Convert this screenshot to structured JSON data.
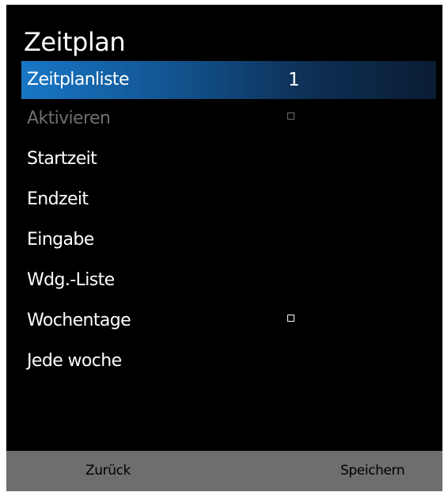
{
  "menu": {
    "title": "Zeitplan",
    "items": [
      {
        "label": "Zeitplanliste",
        "value": "1"
      },
      {
        "label": "Aktivieren"
      },
      {
        "label": "Startzeit"
      },
      {
        "label": "Endzeit"
      },
      {
        "label": "Eingabe"
      },
      {
        "label": "Wdg.-Liste"
      },
      {
        "label": "Wochentage"
      },
      {
        "label": "Jede woche"
      }
    ]
  },
  "footer": {
    "back_label": "Zurück",
    "save_label": "Speichern"
  },
  "colors": {
    "background": "#000000",
    "highlight_start": "#1877c6",
    "highlight_end": "#0a1c33",
    "disabled_text": "#6e6e6e",
    "footer_bar": "#6e6e6e"
  }
}
